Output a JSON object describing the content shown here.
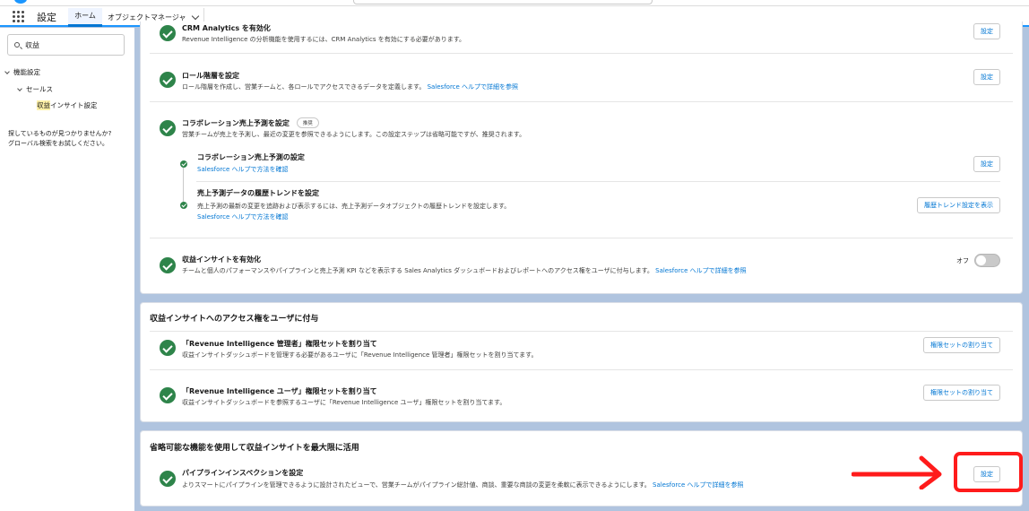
{
  "app": {
    "name": "設定",
    "tabs": [
      {
        "label": "ホーム"
      },
      {
        "label": "オブジェクトマネージャ"
      }
    ]
  },
  "sidebar": {
    "quickfind_value": "収益",
    "tree": {
      "root": "機能設定",
      "child": "セールス",
      "leaf_highlight": "収益",
      "leaf_rest": "インサイト設定"
    },
    "not_found_line1": "探しているものが見つかりませんか?",
    "not_found_line2": "グローバル検索をお試しください。"
  },
  "setup_steps": {
    "crm": {
      "title": "CRM Analytics を有効化",
      "desc": "Revenue Intelligence の分析機能を使用するには、CRM Analytics を有効にする必要があります。",
      "button": "設定"
    },
    "role": {
      "title": "ロール階層を設定",
      "desc": "ロール階層を作成し、営業チームと、各ロールでアクセスできるデータを定義します。",
      "link": "Salesforce ヘルプで詳細を参照",
      "button": "設定"
    },
    "collab": {
      "title": "コラボレーション売上予測を設定",
      "badge": "推奨",
      "desc": "営業チームが売上を予測し、最近の変更を参照できるようにします。この設定ステップは省略可能ですが、推奨されます。",
      "sub1": {
        "title": "コラボレーション売上予測の設定",
        "link": "Salesforce ヘルプで方法を確認",
        "button": "設定"
      },
      "sub2": {
        "title": "売上予測データの履歴トレンドを設定",
        "desc": "売上予測の最新の変更を追跡および表示するには、売上予測データオブジェクトの履歴トレンドを設定します。",
        "link": "Salesforce ヘルプで方法を確認",
        "button": "履歴トレンド設定を表示"
      }
    },
    "enable": {
      "title": "収益インサイトを有効化",
      "desc": "チームと個人のパフォーマンスやパイプラインと売上予測 KPI などを表示する Sales Analytics ダッシュボードおよびレポートへのアクセス権をユーザに付与します。",
      "link": "Salesforce ヘルプで詳細を参照",
      "toggle_label": "オフ",
      "toggle_on": false
    }
  },
  "access": {
    "section_title": "収益インサイトへのアクセス権をユーザに付与",
    "admin": {
      "title": "「Revenue Intelligence 管理者」権限セットを割り当て",
      "desc": "収益インサイトダッシュボードを管理する必要があるユーザに「Revenue Intelligence 管理者」権限セットを割り当てます。",
      "button": "権限セットの割り当て"
    },
    "user": {
      "title": "「Revenue Intelligence ユーザ」権限セットを割り当て",
      "desc": "収益インサイトダッシュボードを参照するユーザに「Revenue Intelligence ユーザ」権限セットを割り当てます。",
      "button": "権限セットの割り当て"
    }
  },
  "optional": {
    "section_title": "省略可能な機能を使用して収益インサイトを最大限に活用",
    "pipeline": {
      "title": "パイプラインインスペクションを設定",
      "desc": "よりスマートにパイプラインを管理できるように設計されたビューで、営業チームがパイプライン総計値、商談、重要な商談の変更を柔軟に表示できるようにします。",
      "link": "Salesforce ヘルプで詳細を参照",
      "button": "設定"
    }
  },
  "colors": {
    "brand_blue": "#0176d3",
    "success_green": "#2e844a",
    "annotation_red": "#ff1b1b",
    "background": "#b0c4df"
  }
}
